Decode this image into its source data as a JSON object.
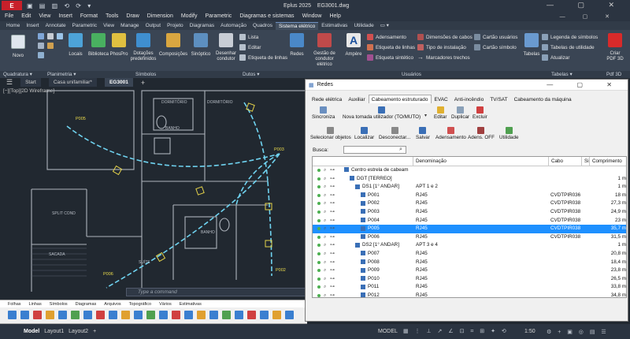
{
  "app": {
    "title": "Eplus 2025",
    "file": "EG3001.dwg",
    "logo": "E",
    "quick_access": "▣ ▤ ▥ ⟲ ⟳ ▾"
  },
  "menu": [
    "File",
    "Edit",
    "View",
    "Insert",
    "Format",
    "Tools",
    "Draw",
    "Dimension",
    "Modify",
    "Parametric",
    "Diagramas e sistemas",
    "Window",
    "Help"
  ],
  "ribbon_tabs": [
    "Home",
    "Insert",
    "Annotate",
    "Parametric",
    "View",
    "Manage",
    "Output",
    "Projeto",
    "Diagramas",
    "Automação",
    "Quadros",
    "Sistema elétrico",
    "Estimativas",
    "Utilidade",
    "▭ ▾"
  ],
  "ribbon_active_tab": "Sistema elétrico",
  "ribbon": {
    "novo": "Novo",
    "locais": "Locais",
    "biblioteca": "Biblioteca",
    "phospro": "PhosPro",
    "dotacoes": "Dotações predefinidos",
    "composicoes": "Composições",
    "sinoptico": "Sinóptico",
    "desenhar_condutor": "Desenhar condutor",
    "lista": "Lista",
    "editar": "Editar",
    "etiqueta_linhas": "Etiqueta de linhas",
    "redes": "Redes",
    "gestao_condutor": "Gestão de condutor elétrico",
    "ampere": "Ampère",
    "adensamento": "Adensamento",
    "etiqueta_linhas2": "Etiqueta de linhas",
    "etiqueta_sintetico": "Etiqueta sintético",
    "dimensoes_cabos": "Dimensões de cabos",
    "tipo_instalacao": "Tipo de instalação",
    "marcadores_trechos": "Marcadores trechos",
    "cartao_usuarios": "Cartão usuários",
    "cartao_simbolo": "Cartão símbolo",
    "tabelas": "Tabelas",
    "legenda_simbolos": "Legenda de símbolos",
    "tabelas_utilidade": "Tabelas de utilidade",
    "atualizar": "Atualizar",
    "criar_pdf": "Criar PDF 3D"
  },
  "ribbon_panels": [
    "Quadratura ▾",
    "Planimetria ▾",
    "Símbolos",
    "Dutos ▾",
    "Usuários",
    "Tabelas ▾",
    "Pdf 3D"
  ],
  "doc_tabs": {
    "menu_icon": "☰",
    "start": "Start",
    "tab1": "Casa unifamiliar*",
    "tab2": "EG3001",
    "add": "+"
  },
  "view_label": "[−][Top][2D Wireframe]",
  "drawing_labels": {
    "dormitorio1": "DORMITÓRIO",
    "dormitorio2": "DORMITÓRIO",
    "banheiro1": "BANHO",
    "banheiro2": "BANHO",
    "sacada": "SACADA",
    "suite": "SUÍTE",
    "split": "SPLIT COND",
    "p005": "P005",
    "p006": "P006",
    "p002": "P002",
    "p003": "P003"
  },
  "command_placeholder": "Type a command",
  "tool_tabs": [
    "Folhas",
    "Linhas",
    "Símbolos",
    "Diagramas",
    "Arquivos",
    "Topográfico",
    "Vários",
    "Estimativas"
  ],
  "status": {
    "model": "Model",
    "layout1": "Layout1",
    "layout2": "Layout2",
    "add": "+",
    "model_btn": "MODEL",
    "scale": "1:50"
  },
  "redes": {
    "title": "Redes",
    "tabs": [
      "Rede elétrica",
      "Auxiliar",
      "Cabeamento estruturado",
      "EVAC",
      "Anti-incêndio",
      "TV/SAT",
      "Cabeamento da máquina"
    ],
    "active_tab": "Cabeamento estruturado",
    "toolbar1": [
      "Sincroniza",
      "Nova tomada utilizador (TO/MUTO)",
      "Editar",
      "Duplicar",
      "Excluir"
    ],
    "toolbar2": [
      "Selecionar objetos",
      "Localizar",
      "Desconectar...",
      "Salvar",
      "Adensamento",
      "Adens. OFF",
      "Utilidade"
    ],
    "search_label": "Busca:",
    "search_value": "",
    "columns": [
      "Denominação",
      "Cabo",
      "Sis",
      "Comprimento"
    ],
    "rows": [
      {
        "level": 0,
        "name": "Centro estrela de cabeam",
        "den": "",
        "cabo": "",
        "comp": "",
        "sel": false
      },
      {
        "level": 1,
        "name": "DGT [TERREO]",
        "den": "",
        "cabo": "",
        "comp": "1 m",
        "sel": false
      },
      {
        "level": 2,
        "name": "DS1 [1° ANDAR]",
        "den": "APT 1 e 2",
        "cabo": "",
        "comp": "1 m",
        "sel": false
      },
      {
        "level": 3,
        "name": "P001",
        "den": "RJ45",
        "cabo": "CVDTPIR036 L",
        "comp": "18 m",
        "sel": false
      },
      {
        "level": 3,
        "name": "P002",
        "den": "RJ45",
        "cabo": "CVDTPIR038 L",
        "comp": "27,3 m",
        "sel": false
      },
      {
        "level": 3,
        "name": "P003",
        "den": "RJ45",
        "cabo": "CVDTPIR038 L",
        "comp": "24,9 m",
        "sel": false
      },
      {
        "level": 3,
        "name": "P004",
        "den": "RJ45",
        "cabo": "CVDTPIR038 L",
        "comp": "23 m",
        "sel": false
      },
      {
        "level": 3,
        "name": "P005",
        "den": "RJ45",
        "cabo": "CVDTPIR038 L",
        "comp": "35,7 m",
        "sel": true
      },
      {
        "level": 3,
        "name": "P006",
        "den": "RJ45",
        "cabo": "CVDTPIR038 L",
        "comp": "31,5 m",
        "sel": false
      },
      {
        "level": 2,
        "name": "DS2 [1° ANDAR]",
        "den": "APT 3 e 4",
        "cabo": "",
        "comp": "1 m",
        "sel": false
      },
      {
        "level": 3,
        "name": "P007",
        "den": "RJ45",
        "cabo": "",
        "comp": "20,8 m",
        "sel": false
      },
      {
        "level": 3,
        "name": "P008",
        "den": "RJ45",
        "cabo": "",
        "comp": "18,4 m",
        "sel": false
      },
      {
        "level": 3,
        "name": "P009",
        "den": "RJ45",
        "cabo": "",
        "comp": "23,8 m",
        "sel": false
      },
      {
        "level": 3,
        "name": "P010",
        "den": "RJ45",
        "cabo": "",
        "comp": "26,5 m",
        "sel": false
      },
      {
        "level": 3,
        "name": "P011",
        "den": "RJ45",
        "cabo": "",
        "comp": "33,8 m",
        "sel": false
      },
      {
        "level": 3,
        "name": "P012",
        "den": "RJ45",
        "cabo": "",
        "comp": "34,8 m",
        "sel": false
      }
    ]
  },
  "colors": {
    "accent": "#1e90ff",
    "route": "#6fd3f0",
    "brand": "#c8202a"
  }
}
